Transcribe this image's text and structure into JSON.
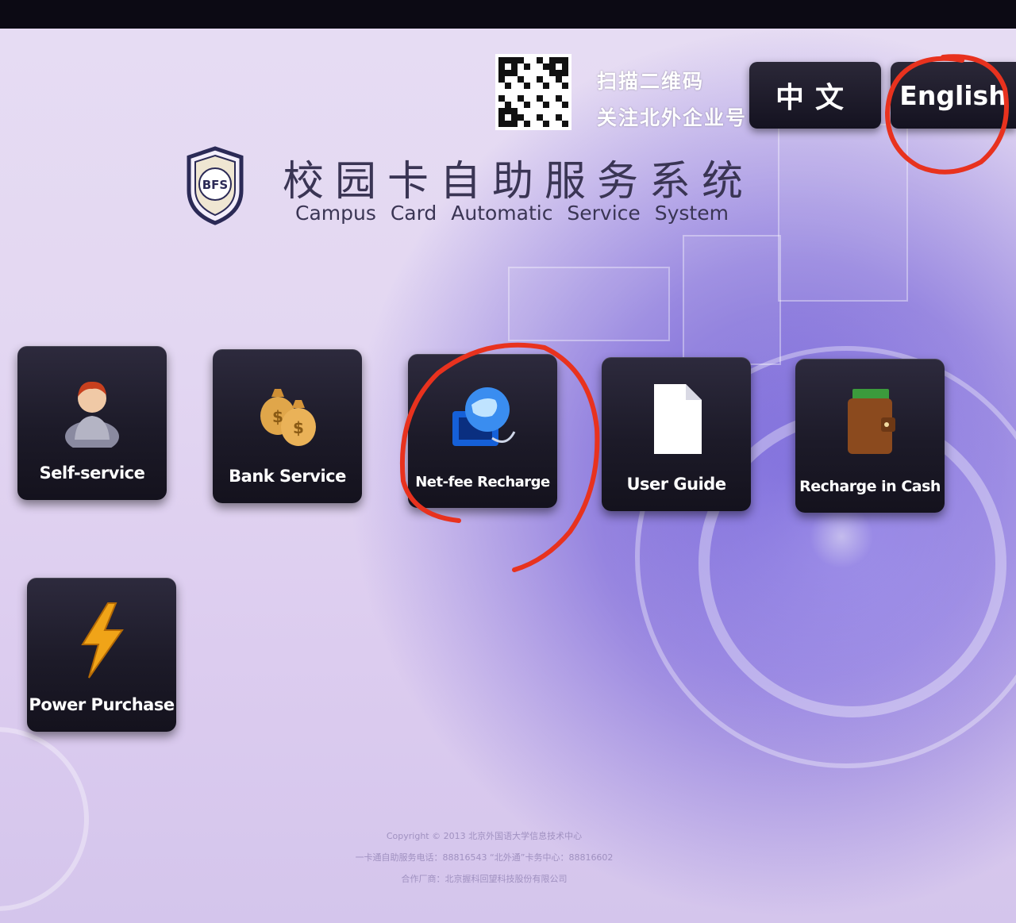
{
  "qr": {
    "line1": "扫描二维码",
    "line2": "关注北外企业号"
  },
  "language": {
    "chinese_label": "中文",
    "english_label": "English"
  },
  "header": {
    "title_cn": "校园卡自助服务系统",
    "title_en": "Campus Card Automatic Service System",
    "logo_text": "BFS"
  },
  "tiles": [
    {
      "label": "Self-service",
      "icon": "person-icon"
    },
    {
      "label": "Bank Service",
      "icon": "money-bags-icon"
    },
    {
      "label": "Net-fee Recharge",
      "icon": "globe-network-icon"
    },
    {
      "label": "User Guide",
      "icon": "document-icon"
    },
    {
      "label": "Recharge in Cash",
      "icon": "wallet-icon"
    },
    {
      "label": "Power Purchase",
      "icon": "lightning-icon"
    }
  ],
  "footer": {
    "copyright": "Copyright © 2013 北京外国语大学信息技术中心",
    "hotline": "一卡通自助服务电话：88816543 “北外通”卡务中心：88816602",
    "partner": "合作厂商：北京握科回望科技股份有限公司"
  },
  "colors": {
    "annotation_red": "#e8321e",
    "tile_dark": "#1c1a28",
    "title_text": "#3a3554"
  }
}
